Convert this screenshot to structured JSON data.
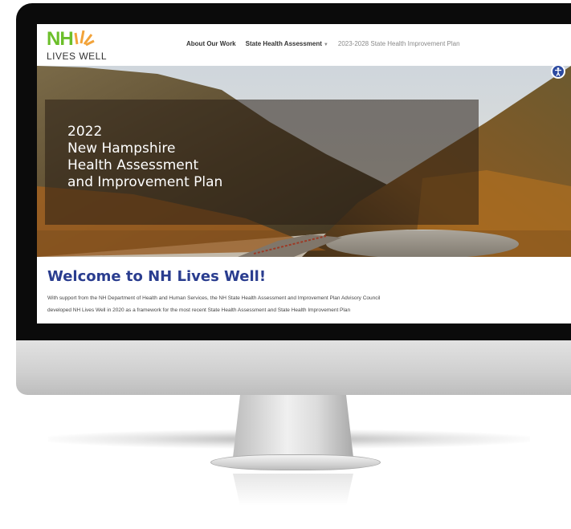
{
  "header": {
    "logo_primary": "NH",
    "logo_secondary": "LIVES WELL",
    "nav": [
      {
        "label": "About Our Work"
      },
      {
        "label": "State Health Assessment"
      },
      {
        "label": "2023-2028 State Health Improvement Plan"
      }
    ]
  },
  "hero": {
    "title_lines": [
      "2022",
      "New Hampshire",
      "Health Assessment",
      "and Improvement Plan"
    ]
  },
  "welcome": {
    "heading": "Welcome to NH Lives Well!",
    "body_lines": [
      "With support from the NH Department of Health and Human Services, the NH State Health Assessment and Improvement Plan Advisory Council",
      "developed NH Lives Well in 2020 as a framework for the most recent State Health Assessment and State Health Improvement Plan"
    ]
  },
  "icons": {
    "accessibility": "accessibility-icon",
    "dropdown": "chevron-down-icon"
  },
  "colors": {
    "brand_green": "#6cbf2a",
    "brand_orange": "#f2a33a",
    "heading_blue": "#2a3d8f",
    "accessibility_blue": "#2c4aa0"
  }
}
